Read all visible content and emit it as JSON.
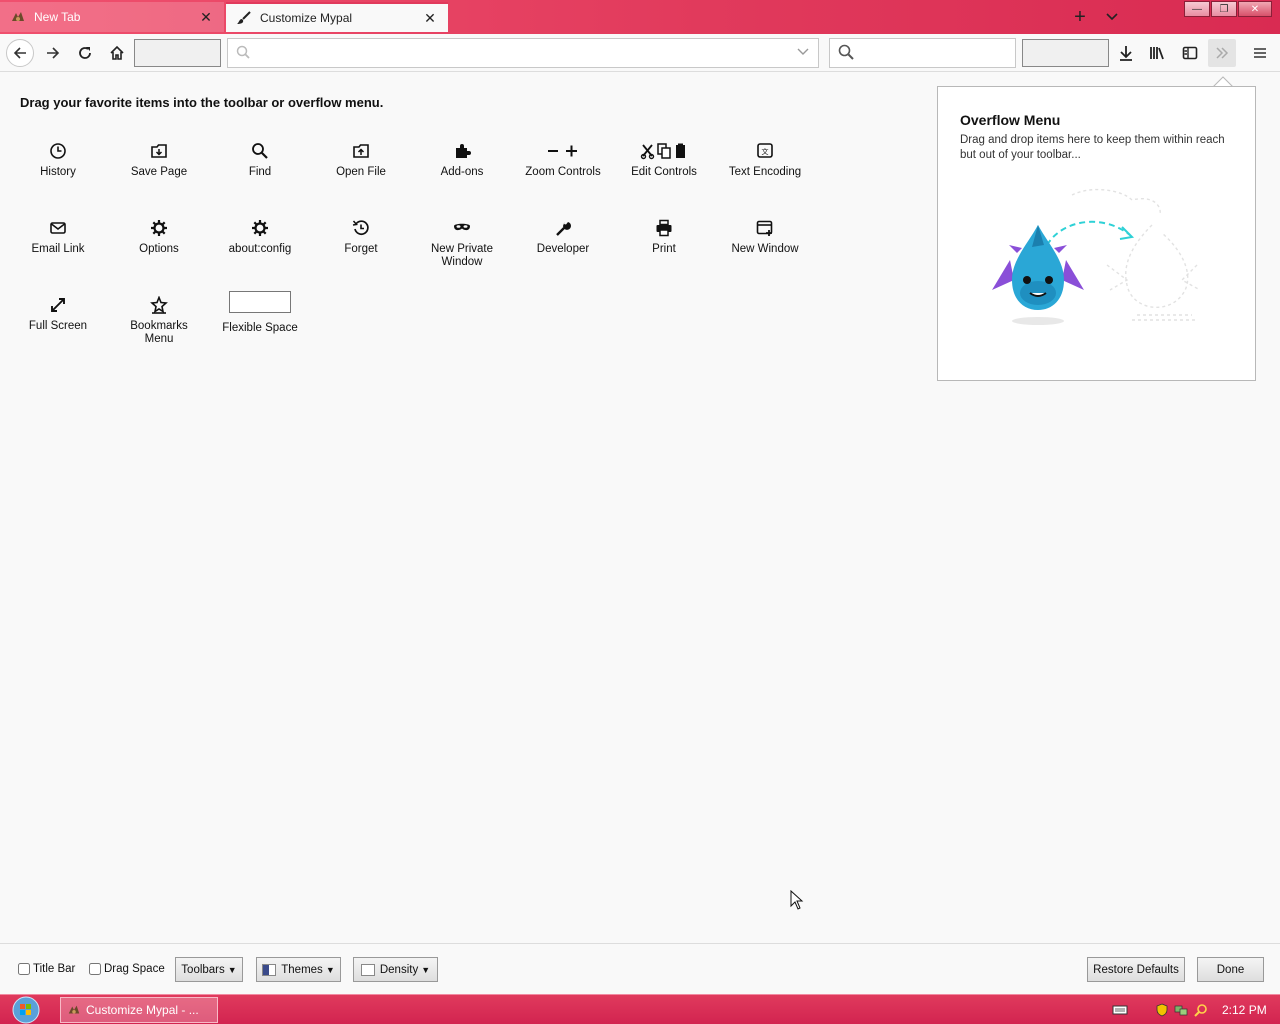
{
  "tabs": [
    {
      "label": "New Tab",
      "close_glyph": "✕",
      "icon": "dragon-favicon-icon"
    },
    {
      "label": "Customize Mypal",
      "close_glyph": "✕",
      "icon": "paintbrush-icon"
    }
  ],
  "tabstrip": {
    "new_tab_glyph": "+"
  },
  "window_controls": {
    "minimize": "—",
    "maximize": "❐",
    "close": "✕"
  },
  "navbar": {
    "urlbar_value": "",
    "searchbar_value": ""
  },
  "palette": {
    "heading": "Drag your favorite items into the toolbar or overflow menu.",
    "items": [
      {
        "label": "History",
        "icon": "clock-icon"
      },
      {
        "label": "Save Page",
        "icon": "save-page-icon"
      },
      {
        "label": "Find",
        "icon": "search-icon"
      },
      {
        "label": "Open File",
        "icon": "open-file-icon"
      },
      {
        "label": "Add-ons",
        "icon": "puzzle-icon"
      },
      {
        "label": "Zoom Controls",
        "icon": "zoom-controls-icon"
      },
      {
        "label": "Edit Controls",
        "icon": "edit-controls-icon"
      },
      {
        "label": "Text Encoding",
        "icon": "text-encoding-icon"
      },
      {
        "label": "Email Link",
        "icon": "envelope-icon"
      },
      {
        "label": "Options",
        "icon": "gear-icon"
      },
      {
        "label": "about:config",
        "icon": "gear-icon"
      },
      {
        "label": "Forget",
        "icon": "forget-icon"
      },
      {
        "label": "New Private\nWindow",
        "icon": "mask-icon"
      },
      {
        "label": "Developer",
        "icon": "wrench-icon"
      },
      {
        "label": "Print",
        "icon": "printer-icon"
      },
      {
        "label": "New Window",
        "icon": "new-window-icon"
      },
      {
        "label": "Full Screen",
        "icon": "fullscreen-icon"
      },
      {
        "label": "Bookmarks\nMenu",
        "icon": "bookmark-star-icon"
      },
      {
        "label": "Flexible Space",
        "icon": "flexible-space"
      }
    ]
  },
  "overflow_panel": {
    "title": "Overflow Menu",
    "description": "Drag and drop items here to keep them within reach but out of your toolbar..."
  },
  "footer": {
    "title_bar_label": "Title Bar",
    "drag_space_label": "Drag Space",
    "toolbars_label": "Toolbars",
    "themes_label": "Themes",
    "density_label": "Density",
    "restore_defaults_label": "Restore Defaults",
    "done_label": "Done"
  },
  "taskbar": {
    "task_label": "Customize Mypal - ...",
    "clock": "2:12 PM"
  },
  "colors": {
    "tabstrip_accent": "#e13a5c",
    "taskbar": "#d92b52",
    "page_bg": "#f9f9f9",
    "illustration_blue": "#2aa7d6",
    "illustration_purple": "#8a4fd8",
    "illustration_cyan_dash": "#2ed1d6"
  }
}
